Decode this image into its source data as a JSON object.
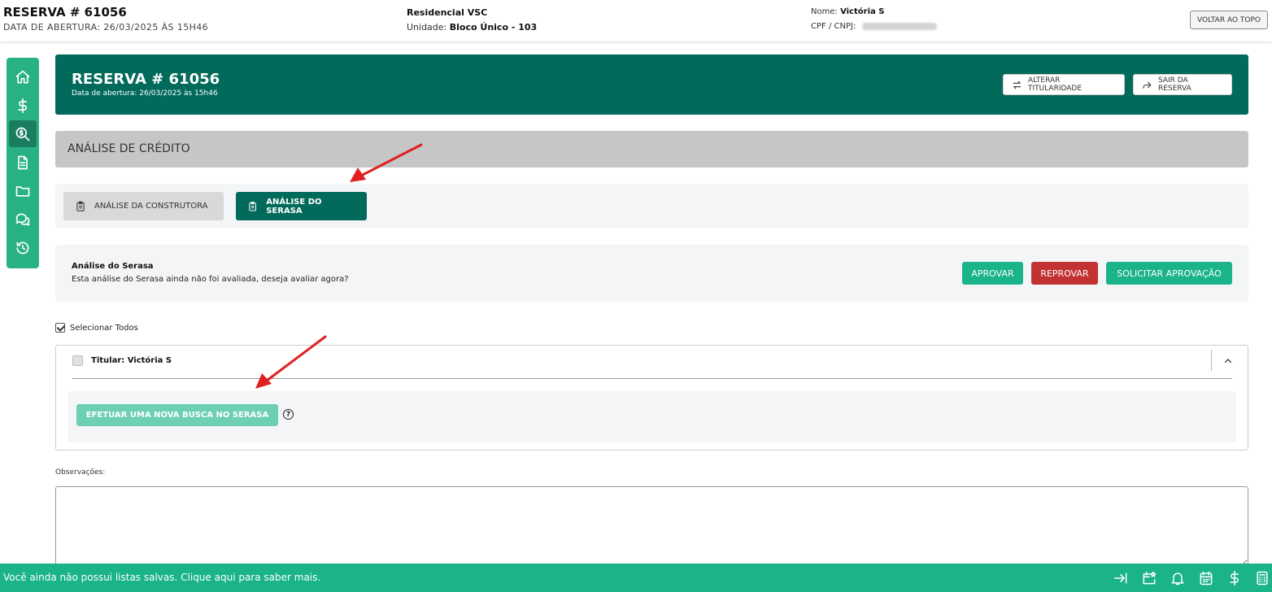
{
  "topbar": {
    "title": "RESERVA # 61056",
    "opening_date": "DATA DE ABERTURA: 26/03/2025 ÀS 15H46",
    "project": "Residencial VSC",
    "unit_label": "Unidade:",
    "unit_value": "Bloco Único - 103",
    "name_label": "Nome:",
    "name_value": "Victória S",
    "cpf_label": "CPF / CNPJ:",
    "back_to_top": "VOLTAR AO TOPO"
  },
  "sidebar": {
    "items": [
      {
        "icon": "home-icon"
      },
      {
        "icon": "dollar-icon"
      },
      {
        "icon": "credit-search-icon",
        "active": true
      },
      {
        "icon": "document-icon"
      },
      {
        "icon": "folder-icon"
      },
      {
        "icon": "chat-icon"
      },
      {
        "icon": "history-icon"
      }
    ]
  },
  "header": {
    "title": "RESERVA # 61056",
    "subtitle": "Data de abertura: 26/03/2025 às 15h46",
    "change_ownership": "ALTERAR TITULARIDADE",
    "exit_reservation": "SAIR DA RESERVA"
  },
  "section": {
    "title": "ANÁLISE DE CRÉDITO"
  },
  "tabs": [
    {
      "label": "ANÁLISE DA CONSTRUTORA",
      "active": false
    },
    {
      "label": "ANÁLISE DO SERASA",
      "active": true
    }
  ],
  "analysis": {
    "title": "Análise do Serasa",
    "text": "Esta análise do Serasa ainda não foi avaliada, deseja avaliar agora?",
    "approve": "APROVAR",
    "reject": "REPROVAR",
    "request_approval": "SOLICITAR APROVAÇÃO"
  },
  "select_all": {
    "label": "Selecionar Todos",
    "checked": true
  },
  "holder": {
    "title": "Titular: Victória S",
    "new_search": "EFETUAR UMA NOVA BUSCA NO SERASA",
    "help": "?"
  },
  "observations": {
    "label": "Observações:",
    "value": ""
  },
  "bottombar": {
    "text": "Você ainda não possui listas salvas. Clique aqui para saber mais.",
    "icons": [
      "arrow-to-right-icon",
      "calendar-star-icon",
      "bell-icon",
      "calendar-icon",
      "dollar-icon",
      "calculator-icon"
    ]
  },
  "colors": {
    "primary_dark": "#016a5a",
    "primary": "#1ab38a",
    "danger": "#c33232",
    "annotation_arrow": "#e02020"
  }
}
